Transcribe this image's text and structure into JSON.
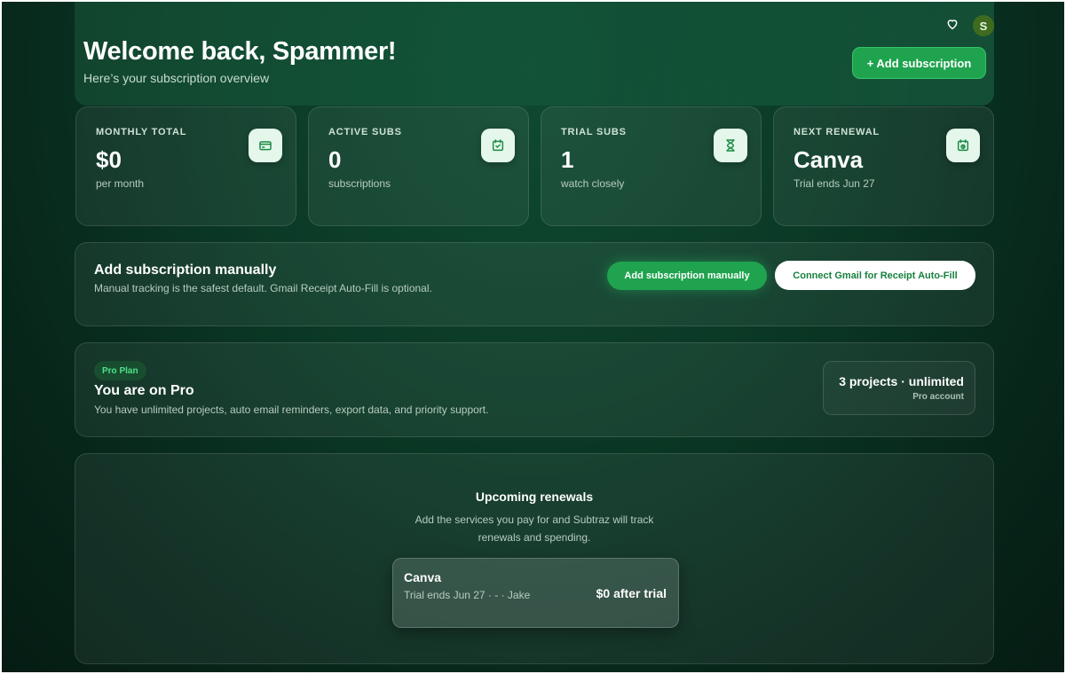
{
  "header": {
    "title": "Welcome back, Spammer!",
    "subtitle": "Here’s your subscription overview",
    "heart_icon": "heart-icon",
    "avatar_initial": "S",
    "add_button": "+ Add subscription"
  },
  "stats": [
    {
      "label": "MONTHLY TOTAL",
      "value": "$0",
      "caption": "per month",
      "icon": "credit-card-icon"
    },
    {
      "label": "ACTIVE SUBS",
      "value": "0",
      "caption": "subscriptions",
      "icon": "calendar-check-icon"
    },
    {
      "label": "TRIAL SUBS",
      "value": "1",
      "caption": "watch closely",
      "icon": "hourglass-icon"
    },
    {
      "label": "NEXT RENEWAL",
      "value": "Canva",
      "caption": "Trial ends Jun 27",
      "icon": "calendar-clock-icon"
    }
  ],
  "manual": {
    "title": "Add subscription manually",
    "description": "Manual tracking is the safest default. Gmail Receipt Auto-Fill is optional.",
    "primary_button": "Add subscription manually",
    "secondary_button": "Connect Gmail for Receipt Auto-Fill"
  },
  "plan": {
    "badge": "Pro Plan",
    "title": "You are on Pro",
    "description": "You have unlimited projects, auto email reminders, export data, and priority support.",
    "box_title": "3 projects · unlimited",
    "box_subtitle": "Pro account"
  },
  "upcoming": {
    "title": "Upcoming renewals",
    "description_line1": "Add the services you pay for and Subtraz will track",
    "description_line2": "renewals and spending.",
    "items": [
      {
        "name": "Canva",
        "meta": "Trial ends Jun 27 · - · Jake",
        "price": "$0 after trial"
      }
    ]
  },
  "colors": {
    "accent_green": "#1fa34f",
    "icon_tile": "#e4f7ea",
    "background_dark": "#07261a"
  }
}
